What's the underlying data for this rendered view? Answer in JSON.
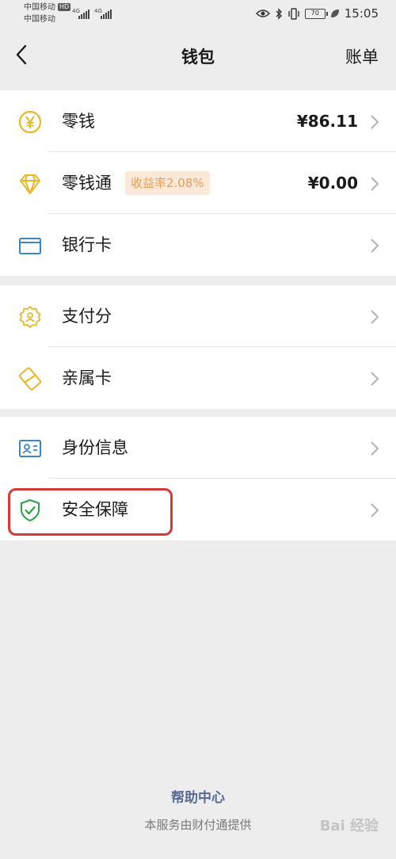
{
  "status_bar": {
    "carrier1": "中国移动",
    "carrier2": "中国移动",
    "hd": "HD",
    "net1": "4G",
    "net2": "4G",
    "battery": "70",
    "time": "15:05"
  },
  "nav": {
    "title": "钱包",
    "right_label": "账单"
  },
  "sections": [
    {
      "items": [
        {
          "label": "零钱",
          "value": "¥86.11"
        },
        {
          "label": "零钱通",
          "badge": "收益率2.08%",
          "value": "¥0.00"
        },
        {
          "label": "银行卡"
        }
      ]
    },
    {
      "items": [
        {
          "label": "支付分"
        },
        {
          "label": "亲属卡"
        }
      ]
    },
    {
      "items": [
        {
          "label": "身份信息"
        },
        {
          "label": "安全保障"
        }
      ]
    }
  ],
  "footer": {
    "help_link": "帮助中心",
    "provider_note": "本服务由财付通提供"
  },
  "watermark": "Bai 经验",
  "colors": {
    "yellow_icon": "#e8b726",
    "blue_icon": "#3a87c8",
    "green_icon": "#2ba245",
    "link": "#576b95",
    "highlight": "#d43a3a"
  }
}
